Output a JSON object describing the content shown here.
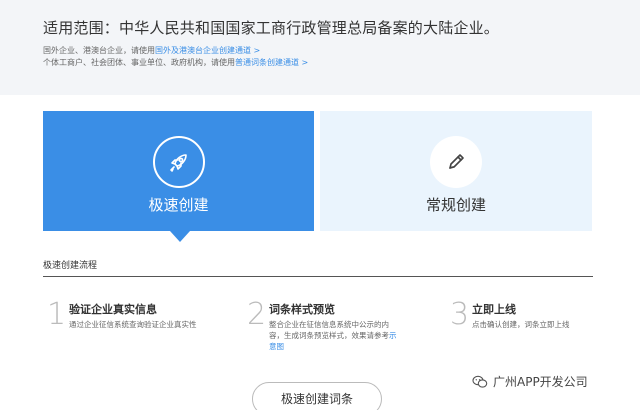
{
  "header": {
    "scope_title": "适用范围：中华人民共和国国家工商行政管理总局备案的大陆企业。",
    "note1": {
      "text": "国外企业、港澳台企业，请使用",
      "link": "国外及港澳台企业创建通道 >"
    },
    "note2": {
      "text": "个体工商户、社会团体、事业单位、政府机构，请使用",
      "link": "普通词条创建通道 >"
    }
  },
  "cards": {
    "fast": {
      "label": "极速创建",
      "icon": "rocket-icon"
    },
    "regular": {
      "label": "常规创建",
      "icon": "pencil-icon"
    }
  },
  "flow": {
    "title": "极速创建流程",
    "steps": [
      {
        "num": "1",
        "title": "验证企业真实信息",
        "desc": "通过企业征信系统查询验证企业真实性"
      },
      {
        "num": "2",
        "title": "词条样式预览",
        "desc": "整合企业在征信信息系统中公示的内容，生成词条预览样式，效果请参考",
        "link": "示意图"
      },
      {
        "num": "3",
        "title": "立即上线",
        "desc": "点击确认创建，词条立即上线"
      }
    ]
  },
  "cta": {
    "label": "极速创建词条"
  },
  "watermark": {
    "text": "广州APP开发公司",
    "icon": "wechat-icon"
  },
  "colors": {
    "accent": "#3a8ee6",
    "card_light": "#eaf4fd",
    "band": "#f3f5f8"
  }
}
